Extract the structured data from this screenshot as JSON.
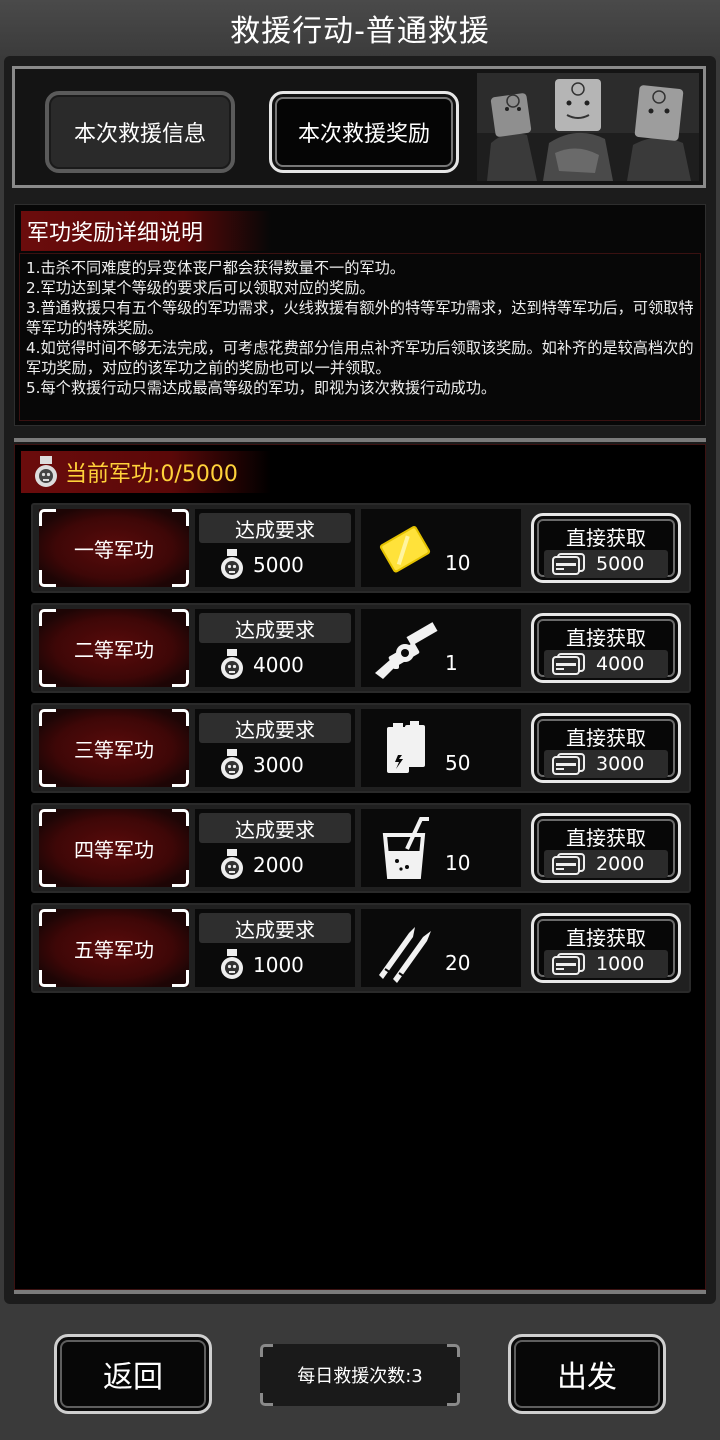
{
  "header": {
    "title": "救援行动-普通救援"
  },
  "tabs": [
    {
      "label": "本次救援信息",
      "active": false
    },
    {
      "label": "本次救援奖励",
      "active": true
    }
  ],
  "description": {
    "title": "军功奖励详细说明",
    "lines": [
      "1.击杀不同难度的异变体丧尸都会获得数量不一的军功。",
      "2.军功达到某个等级的要求后可以领取对应的奖励。",
      "3.普通救援只有五个等级的军功需求，火线救援有额外的特等军功需求，达到特等军功后，可领取特等军功的特殊奖励。",
      "4.如觉得时间不够无法完成，可考虑花费部分信用点补齐军功后领取该奖励。如补齐的是较高档次的军功奖励，对应的该军功之前的奖励也可以一并领取。",
      "5.每个救援行动只需达成最高等级的军功，即视为该次救援行动成功。"
    ]
  },
  "merit": {
    "label": "当前军功:0/5000",
    "current": 0,
    "max": 5000
  },
  "tiers": [
    {
      "rank": "一等军功",
      "req_label": "达成要求",
      "req_value": "5000",
      "reward_icon": "gold-card-icon",
      "reward_qty": "10",
      "buy_label": "直接获取",
      "buy_price": "5000"
    },
    {
      "rank": "二等军功",
      "req_label": "达成要求",
      "req_value": "4000",
      "reward_icon": "grenade-launcher-icon",
      "reward_qty": "1",
      "buy_label": "直接获取",
      "buy_price": "4000"
    },
    {
      "rank": "三等军功",
      "req_label": "达成要求",
      "req_value": "3000",
      "reward_icon": "battery-icon",
      "reward_qty": "50",
      "buy_label": "直接获取",
      "buy_price": "3000"
    },
    {
      "rank": "四等军功",
      "req_label": "达成要求",
      "req_value": "2000",
      "reward_icon": "drink-icon",
      "reward_qty": "10",
      "buy_label": "直接获取",
      "buy_price": "2000"
    },
    {
      "rank": "五等军功",
      "req_label": "达成要求",
      "req_value": "1000",
      "reward_icon": "bullets-icon",
      "reward_qty": "20",
      "buy_label": "直接获取",
      "buy_price": "1000"
    }
  ],
  "footer": {
    "back_label": "返回",
    "daily_count": "每日救援次数:3",
    "go_label": "出发"
  },
  "colors": {
    "accent_gold": "#ffd23a",
    "banner_red": "#6b0c0c",
    "panel_bg": "#000000"
  }
}
